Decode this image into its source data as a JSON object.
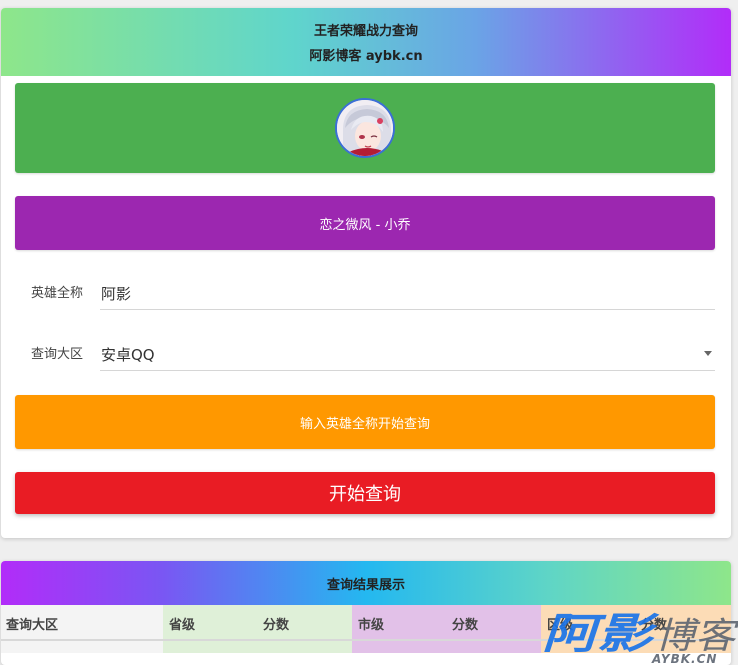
{
  "header": {
    "title": "王者荣耀战力查询",
    "subtitle": "阿影博客 aybk.cn"
  },
  "hero_name": "恋之微风 - 小乔",
  "form": {
    "hero_label": "英雄全称",
    "hero_value": "阿影",
    "region_label": "查询大区",
    "region_value": "安卓QQ"
  },
  "hint": "输入英雄全称开始查询",
  "query_button": "开始查询",
  "results": {
    "title": "查询结果展示",
    "columns": [
      "查询大区",
      "省级",
      "分数",
      "市级",
      "分数",
      "区级",
      "分数"
    ]
  },
  "watermark": {
    "text": "阿影博客",
    "url": "AYBK.CN"
  },
  "colors": {
    "avatar_bg": "#4caf50",
    "hero_bar": "#9c27b0",
    "hint_bar": "#ff9800",
    "query_button": "#e91c24"
  }
}
